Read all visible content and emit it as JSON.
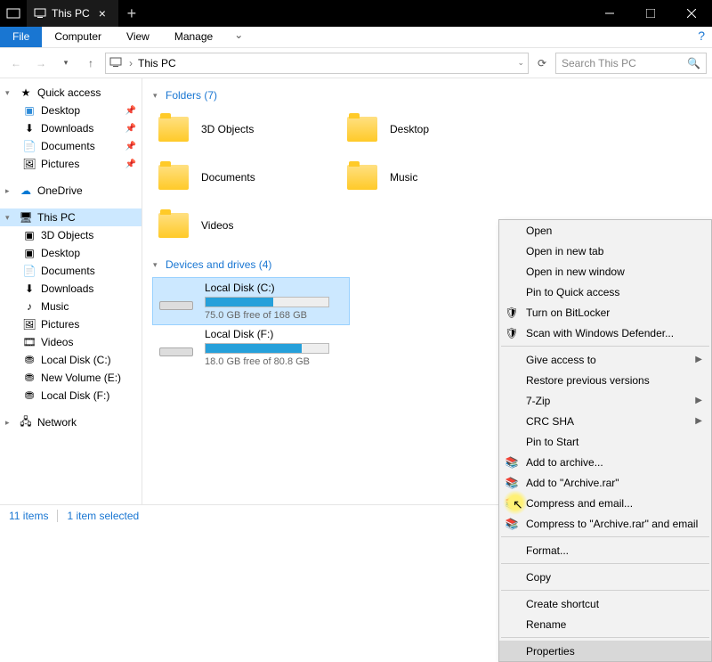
{
  "titlebar": {
    "title": "This PC"
  },
  "ribbon": {
    "file": "File",
    "tabs": [
      "Computer",
      "View",
      "Manage"
    ]
  },
  "address": {
    "location": "This PC",
    "search_placeholder": "Search This PC"
  },
  "nav": {
    "quick_access": "Quick access",
    "pinned": [
      "Desktop",
      "Downloads",
      "Documents",
      "Pictures"
    ],
    "onedrive": "OneDrive",
    "thispc": "This PC",
    "thispc_children": [
      "3D Objects",
      "Desktop",
      "Documents",
      "Downloads",
      "Music",
      "Pictures",
      "Videos",
      "Local Disk (C:)",
      "New Volume (E:)",
      "Local Disk (F:)"
    ],
    "network": "Network"
  },
  "content": {
    "folders_header": "Folders (7)",
    "folders": [
      "3D Objects",
      "Desktop",
      "Documents",
      "Music",
      "Videos"
    ],
    "drives_header": "Devices and drives (4)",
    "drives": [
      {
        "name": "Local Disk (C:)",
        "free": "75.0 GB free of 168 GB",
        "fill": 55
      },
      {
        "name": "Local Disk (F:)",
        "free": "18.0 GB free of 80.8 GB",
        "fill": 78
      }
    ]
  },
  "contextmenu": {
    "items": [
      {
        "label": "Open"
      },
      {
        "label": "Open in new tab"
      },
      {
        "label": "Open in new window"
      },
      {
        "label": "Pin to Quick access"
      },
      {
        "label": "Turn on BitLocker",
        "icon": "shield"
      },
      {
        "label": "Scan with Windows Defender...",
        "icon": "defender"
      },
      {
        "sep": true
      },
      {
        "label": "Give access to",
        "sub": true
      },
      {
        "label": "Restore previous versions"
      },
      {
        "label": "7-Zip",
        "sub": true
      },
      {
        "label": "CRC SHA",
        "sub": true
      },
      {
        "label": "Pin to Start"
      },
      {
        "label": "Add to archive...",
        "icon": "rar"
      },
      {
        "label": "Add to \"Archive.rar\"",
        "icon": "rar"
      },
      {
        "label": "Compress and email...",
        "icon": "rar"
      },
      {
        "label": "Compress to \"Archive.rar\" and email",
        "icon": "rar"
      },
      {
        "sep": true
      },
      {
        "label": "Format..."
      },
      {
        "sep": true
      },
      {
        "label": "Copy"
      },
      {
        "sep": true
      },
      {
        "label": "Create shortcut"
      },
      {
        "label": "Rename"
      },
      {
        "sep": true
      },
      {
        "label": "Properties",
        "hover": true
      }
    ]
  },
  "status": {
    "count": "11 items",
    "selected": "1 item selected"
  }
}
